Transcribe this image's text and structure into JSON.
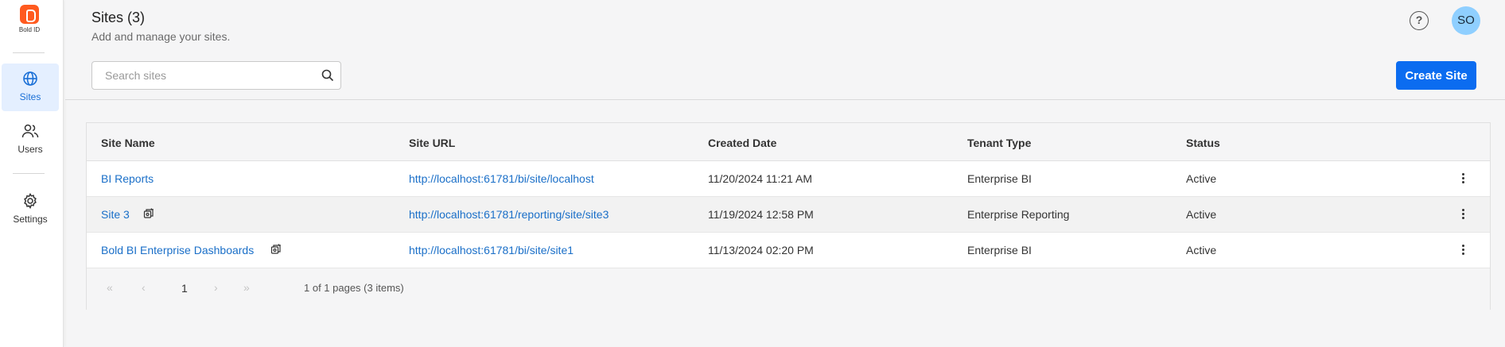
{
  "sidebar": {
    "logo_text": "Bold ID",
    "items": [
      {
        "label": "Sites",
        "icon": "globe-icon",
        "active": true
      },
      {
        "label": "Users",
        "icon": "users-icon",
        "active": false
      },
      {
        "label": "Settings",
        "icon": "gear-icon",
        "active": false
      }
    ]
  },
  "header": {
    "title": "Sites (3)",
    "subtitle": "Add and manage your sites.",
    "help_icon": "help-circle-icon",
    "avatar_initials": "SO"
  },
  "search": {
    "placeholder": "Search sites",
    "value": ""
  },
  "toolbar": {
    "create_label": "Create Site"
  },
  "table": {
    "columns": [
      "Site Name",
      "Site URL",
      "Created Date",
      "Tenant Type",
      "Status"
    ],
    "rows": [
      {
        "name": "BI Reports",
        "url": "http://localhost:61781/bi/site/localhost",
        "created": "11/20/2024 11:21 AM",
        "tenant": "Enterprise BI",
        "status": "Active",
        "has_icon": false
      },
      {
        "name": "Site 3",
        "url": "http://localhost:61781/reporting/site/site3",
        "created": "11/19/2024 12:58 PM",
        "tenant": "Enterprise Reporting",
        "status": "Active",
        "has_icon": true
      },
      {
        "name": "Bold BI Enterprise Dashboards",
        "url": "http://localhost:61781/bi/site/site1",
        "created": "11/13/2024 02:20 PM",
        "tenant": "Enterprise BI",
        "status": "Active",
        "has_icon": true
      }
    ]
  },
  "pager": {
    "first": "«",
    "prev": "‹",
    "current_page": "1",
    "next": "›",
    "last": "»",
    "info": "1 of 1 pages (3 items)"
  },
  "colors": {
    "accent": "#0b6cf0",
    "link": "#1a6fc8",
    "logo": "#ff5a1f",
    "avatar": "#8fcfff"
  }
}
